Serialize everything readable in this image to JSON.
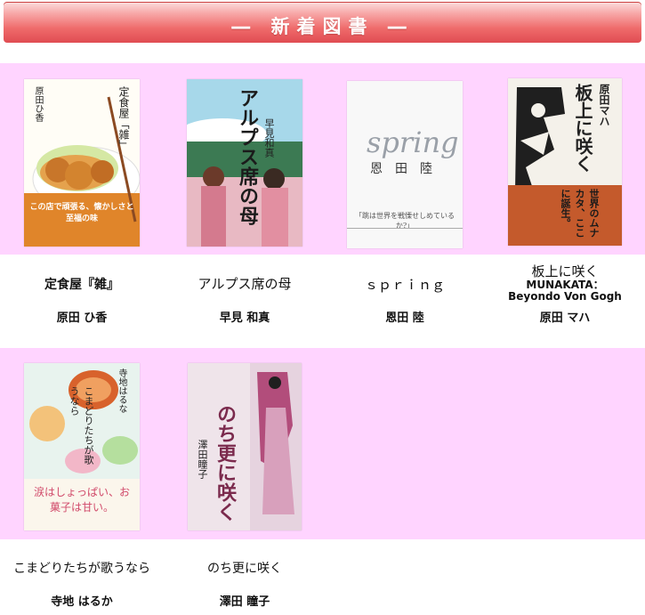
{
  "header": {
    "title": "― 新着図書 ―"
  },
  "books": [
    {
      "title": "定食屋『雑』",
      "author": "原田 ひ香",
      "cover": {
        "v_title": "定食屋「雑」",
        "v_author": "原田ひ香",
        "band": "この店で頑張る、懐かしさと至福の味"
      }
    },
    {
      "title": "アルプス席の母",
      "author": "早見 和真",
      "cover": {
        "v_title": "アルプス席の母",
        "v_author": "早見和真"
      }
    },
    {
      "title": "ｓｐｒｉｎｇ",
      "author": "恩田 陸",
      "cover": {
        "word": "spring",
        "v_author": "恩田陸",
        "band": "「跳は世界を戦慄せしめているか?」"
      }
    },
    {
      "title": "板上に咲く",
      "title_line2": "MUNAKATA：",
      "title_line3": "Beyondo Von Gogh",
      "author": "原田 マハ",
      "cover": {
        "v_title": "板上に咲く",
        "v_author": "原田マハ",
        "sub": "世界のムナカタ、ここに誕生。"
      }
    },
    {
      "title": "こまどりたちが歌うなら",
      "author": "寺地 はるか",
      "cover": {
        "v_title": "こまどりたちが歌うなら",
        "v_author": "寺地はるな",
        "band": "涙はしょっぱい、お菓子は甘い。"
      }
    },
    {
      "title": "のち更に咲く",
      "author": "澤田 瞳子",
      "cover": {
        "v_title": "のち更に咲く",
        "v_author": "澤田瞳子"
      }
    }
  ]
}
